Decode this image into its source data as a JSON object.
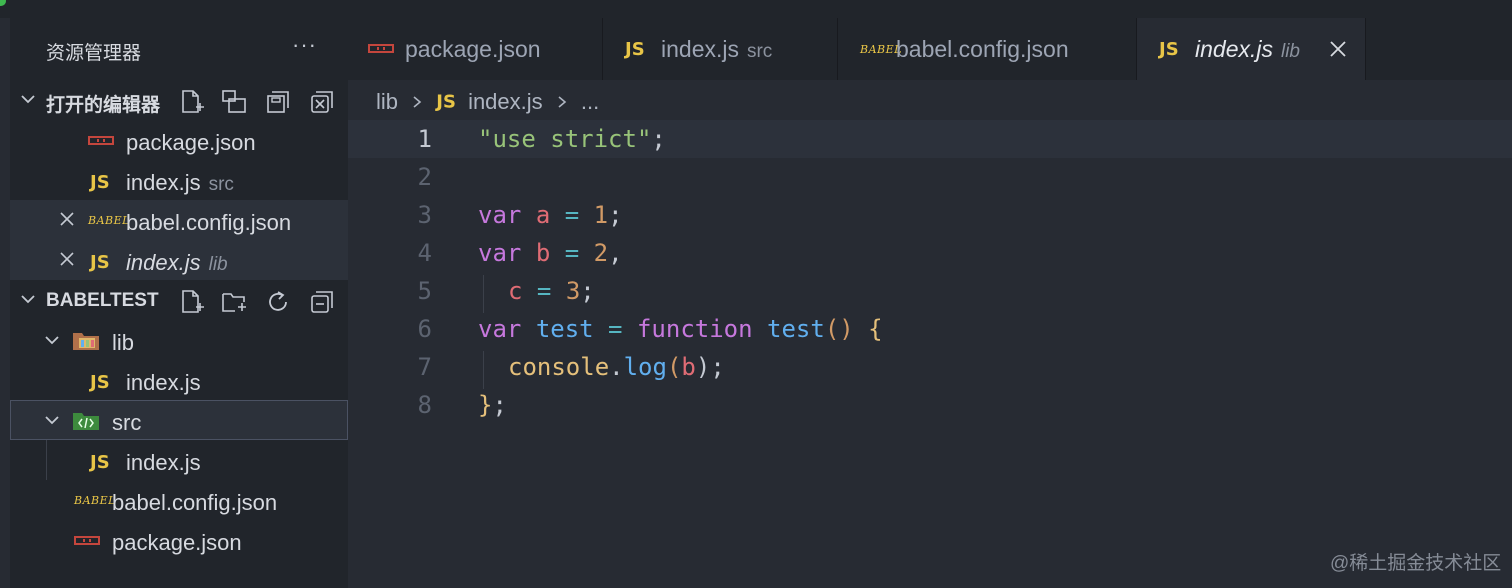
{
  "sidebar": {
    "title": "资源管理器",
    "more": "···",
    "open_editors": {
      "label": "打开的编辑器",
      "items": [
        {
          "name": "package.json",
          "desc": ""
        },
        {
          "name": "index.js",
          "desc": "src"
        },
        {
          "name": "babel.config.json",
          "desc": ""
        },
        {
          "name": "index.js",
          "desc": "lib"
        }
      ]
    },
    "project": {
      "label": "BABELTEST",
      "tree": [
        {
          "name": "lib"
        },
        {
          "name": "index.js"
        },
        {
          "name": "src"
        },
        {
          "name": "index.js"
        },
        {
          "name": "babel.config.json"
        },
        {
          "name": "package.json"
        }
      ]
    }
  },
  "tabs": [
    {
      "label": "package.json",
      "desc": ""
    },
    {
      "label": "index.js",
      "desc": "src"
    },
    {
      "label": "babel.config.json",
      "desc": ""
    },
    {
      "label": "index.js",
      "desc": "lib"
    }
  ],
  "icons": {
    "js": "JS",
    "babel": "BABEL"
  },
  "breadcrumb": {
    "folder": "lib",
    "file": "index.js",
    "ellipsis": "..."
  },
  "editor": {
    "line_numbers": [
      "1",
      "2",
      "3",
      "4",
      "5",
      "6",
      "7",
      "8"
    ]
  },
  "code_tokens": {
    "l1": [
      "\"use strict\"",
      ";"
    ],
    "l3": [
      "var",
      " ",
      "a",
      " = ",
      "1",
      ";"
    ],
    "l4": [
      "var",
      " ",
      "b",
      " = ",
      "2",
      ","
    ],
    "l5": [
      "c",
      " = ",
      "3",
      ";"
    ],
    "l6": [
      "var",
      " ",
      "test",
      " = ",
      "function",
      " ",
      "test",
      "()",
      " ",
      "{"
    ],
    "l7": [
      "console",
      ".",
      "log",
      "(",
      "b",
      ");"
    ],
    "l8": [
      "}",
      ";"
    ]
  },
  "watermark": "@稀土掘金技术社区",
  "colors": {
    "keyword": "#c678dd",
    "string": "#98c379",
    "number": "#d19a66",
    "variable": "#e06c75",
    "function": "#61afef",
    "js_icon": "#e8c547",
    "npm_icon": "#c4463d"
  }
}
